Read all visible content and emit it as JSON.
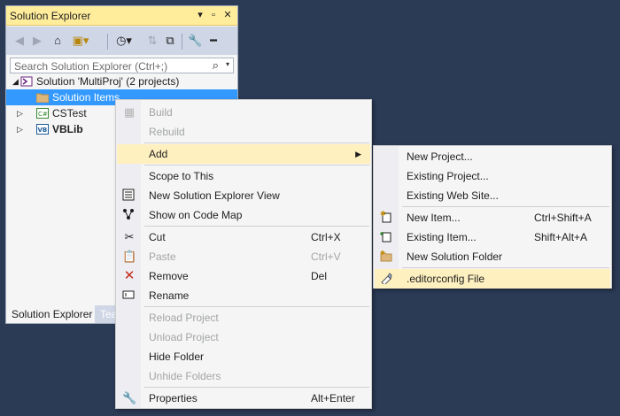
{
  "window": {
    "title": "Solution Explorer",
    "search_placeholder": "Search Solution Explorer (Ctrl+;)"
  },
  "tree": {
    "solution": "Solution 'MultiProj' (2 projects)",
    "solution_items": "Solution Items",
    "cstest": "CSTest",
    "vblib": "VBLib"
  },
  "tabs": {
    "solution_explorer": "Solution Explorer",
    "team": "Tea"
  },
  "context_menu": {
    "build": "Build",
    "rebuild": "Rebuild",
    "add": "Add",
    "scope_to_this": "Scope to This",
    "new_se_view": "New Solution Explorer View",
    "show_on_code_map": "Show on Code Map",
    "cut": "Cut",
    "cut_key": "Ctrl+X",
    "paste": "Paste",
    "paste_key": "Ctrl+V",
    "remove": "Remove",
    "remove_key": "Del",
    "rename": "Rename",
    "reload_project": "Reload Project",
    "unload_project": "Unload Project",
    "hide_folder": "Hide Folder",
    "unhide_folders": "Unhide Folders",
    "properties": "Properties",
    "properties_key": "Alt+Enter"
  },
  "submenu": {
    "new_project": "New Project...",
    "existing_project": "Existing Project...",
    "existing_web_site": "Existing Web Site...",
    "new_item": "New Item...",
    "new_item_key": "Ctrl+Shift+A",
    "existing_item": "Existing Item...",
    "existing_item_key": "Shift+Alt+A",
    "new_solution_folder": "New Solution Folder",
    "editorconfig": ".editorconfig File"
  },
  "colors": {
    "background": "#2b3a55",
    "title_bar": "#ffed9c",
    "selection": "#3399ff",
    "menu_highlight": "#fff0c0"
  }
}
